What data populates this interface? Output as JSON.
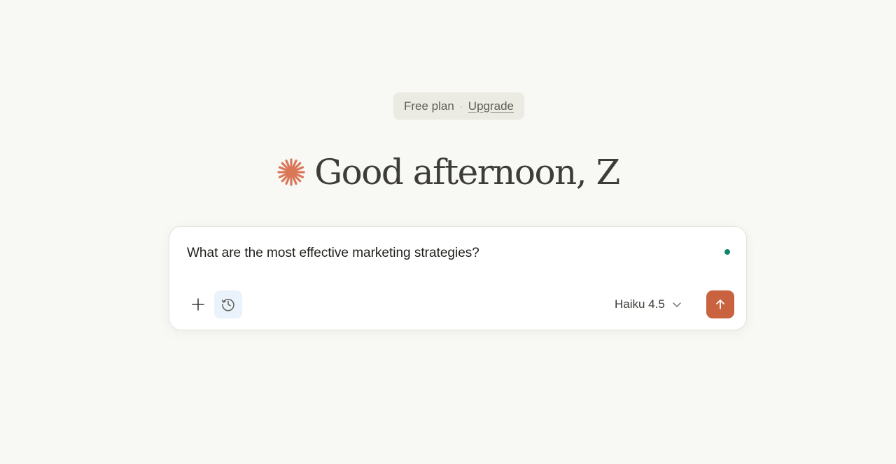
{
  "plan": {
    "label": "Free plan",
    "separator": "·",
    "upgrade_label": "Upgrade"
  },
  "greeting": {
    "icon": "spark-icon",
    "text": "Good afternoon, Z"
  },
  "composer": {
    "prompt_text": "What are the most effective marketing strategies?",
    "add_icon": "plus-icon",
    "history_icon": "clock-history-icon",
    "model_label": "Haiku 4.5",
    "model_chevron": "chevron-down-icon",
    "send_icon": "arrow-up-icon"
  },
  "colors": {
    "background": "#f8f8f5",
    "accent": "#c8623f",
    "spark": "#d97757",
    "status_dot": "#11876b",
    "history_bg": "#eaf2fb"
  }
}
